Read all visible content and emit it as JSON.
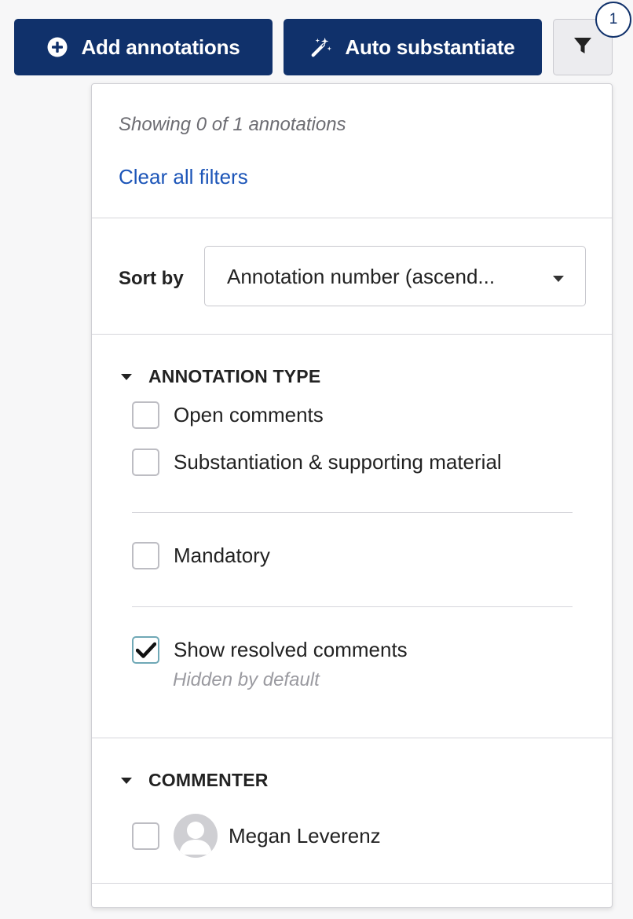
{
  "toolbar": {
    "add_annotations": {
      "label": "Add annotations",
      "icon": "plus-circle-icon"
    },
    "auto_substantiate": {
      "label": "Auto substantiate",
      "icon": "magic-wand-icon"
    },
    "filter": {
      "icon": "filter-icon",
      "badge_count": "1"
    }
  },
  "colors": {
    "primary": "#10316b",
    "link": "#1c55b8",
    "checkbox_focus": "#6fa8b6"
  },
  "filter_panel": {
    "summary": {
      "showing_text": "Showing 0 of 1 annotations",
      "clear_filters": "Clear all filters"
    },
    "sort": {
      "label": "Sort by",
      "selected": "Annotation number (ascend..."
    },
    "annotation_type": {
      "title": "ANNOTATION TYPE",
      "options": [
        {
          "label": "Open comments",
          "checked": false
        },
        {
          "label": "Substantiation & supporting material",
          "checked": false
        },
        {
          "label": "Mandatory",
          "checked": false
        },
        {
          "label": "Show resolved comments",
          "checked": true,
          "hint": "Hidden by default"
        }
      ]
    },
    "commenter": {
      "title": "COMMENTER",
      "people": [
        {
          "name": "Megan Leverenz",
          "checked": false,
          "avatar": "default-avatar-icon"
        }
      ]
    }
  }
}
